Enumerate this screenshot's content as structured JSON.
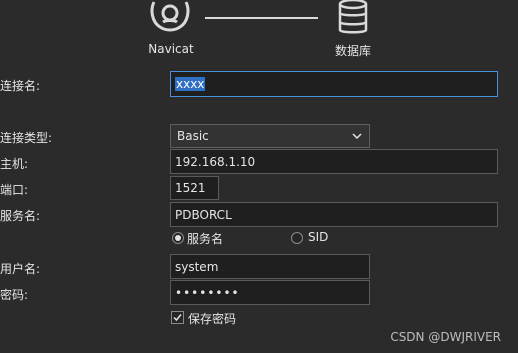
{
  "header": {
    "left_icon": "navicat-icon",
    "left_label": "Navicat",
    "right_icon": "database-icon",
    "right_label": "数据库"
  },
  "form": {
    "connection_name": {
      "label": "连接名:",
      "value": "xxxx"
    },
    "connection_type": {
      "label": "连接类型:",
      "value": "Basic"
    },
    "host": {
      "label": "主机:",
      "value": "192.168.1.10"
    },
    "port": {
      "label": "端口:",
      "value": "1521"
    },
    "service_name": {
      "label": "服务名:",
      "value": "PDBORCL"
    },
    "service_type_options": [
      {
        "label": "服务名",
        "selected": true
      },
      {
        "label": "SID",
        "selected": false
      }
    ],
    "username": {
      "label": "用户名:",
      "value": "system"
    },
    "password": {
      "label": "密码:",
      "value": "••••••••"
    },
    "save_password": {
      "label": "保存密码",
      "checked": true
    }
  },
  "watermark": "CSDN @DWJRIVER",
  "colors": {
    "background": "#2b2b2b",
    "field_background": "#1f1f1f",
    "focus_border": "#4a90d9",
    "selection": "#2f6fc4"
  }
}
